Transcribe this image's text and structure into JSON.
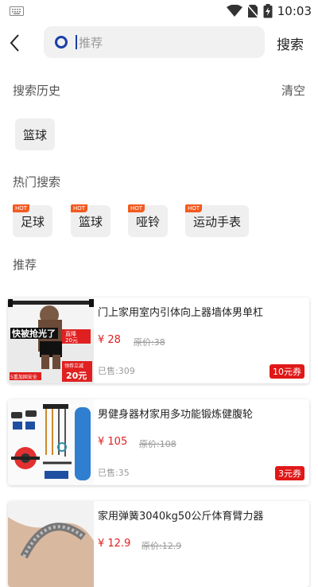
{
  "status_bar": {
    "time": "10:03",
    "icons": [
      "keyboard-icon",
      "wifi-icon",
      "no-sim-icon",
      "battery-icon"
    ]
  },
  "search": {
    "placeholder": "推荐",
    "button_label": "搜索"
  },
  "history": {
    "title": "搜索历史",
    "clear_label": "清空",
    "items": [
      "篮球"
    ]
  },
  "hot": {
    "title": "热门搜索",
    "badge": "HOT",
    "items": [
      "足球",
      "篮球",
      "哑铃",
      "运动手表"
    ]
  },
  "recommend": {
    "title": "推荐",
    "products": [
      {
        "title": "门上家用室内引体向上器墙体男单杠",
        "price": "¥ 28",
        "original_price": "原价:38",
        "sold": "已售:309",
        "coupon": "10元券",
        "image_text": {
          "banner": "快被抢光了",
          "tag1": "直降",
          "tag2": "20元",
          "tag3": "领券立减",
          "tag4": "20元",
          "tag5": "5重加固安全"
        }
      },
      {
        "title": "男健身器材家用多功能锻炼健腹轮",
        "price": "¥ 105",
        "original_price": "原价:108",
        "sold": "已售:35",
        "coupon": "3元券"
      },
      {
        "title": "家用弹簧3040kg50公斤体育臂力器",
        "price": "¥ 12.9",
        "original_price": "原价:12.9"
      }
    ]
  },
  "colors": {
    "accent": "#1a3fa8",
    "price": "#e02020",
    "coupon": "#e01818",
    "hot_badge": "#f25a1f"
  }
}
